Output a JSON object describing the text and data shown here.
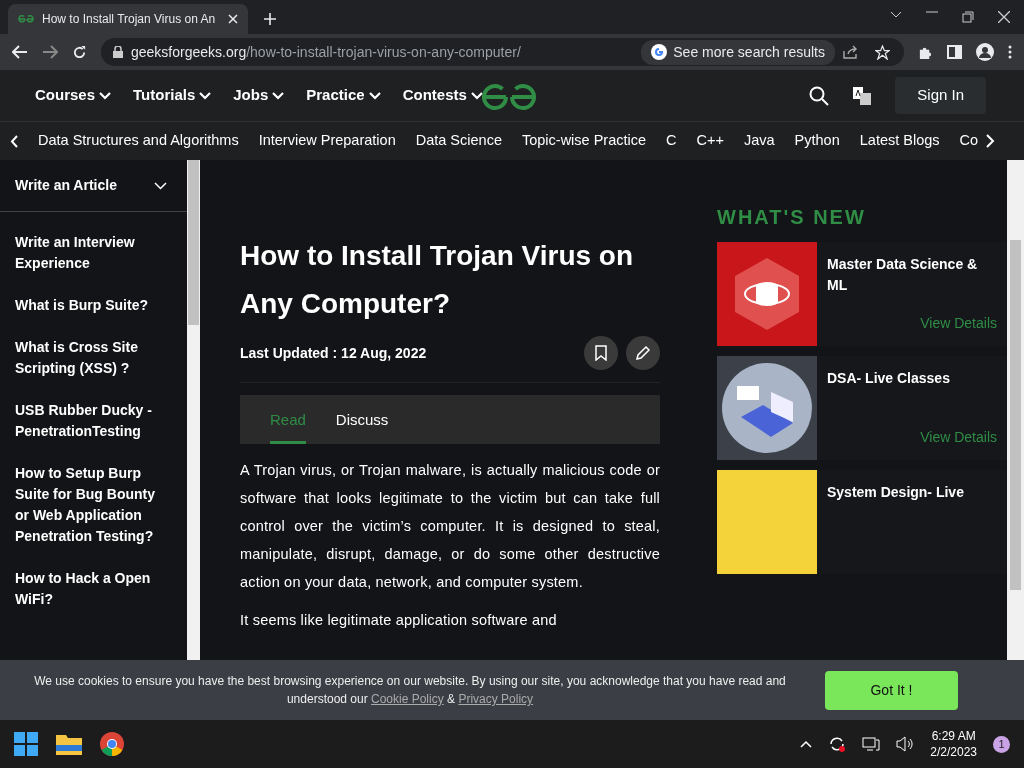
{
  "browser": {
    "tab_title": "How to Install Trojan Virus on An",
    "url_domain": "geeksforgeeks.org",
    "url_path": "/how-to-install-trojan-virus-on-any-computer/",
    "search_chip": "See more search results"
  },
  "site_nav": {
    "items": [
      "Courses",
      "Tutorials",
      "Jobs",
      "Practice",
      "Contests"
    ],
    "sign_in": "Sign In"
  },
  "topic_bar": [
    "Data Structures and Algorithms",
    "Interview Preparation",
    "Data Science",
    "Topic-wise Practice",
    "C",
    "C++",
    "Java",
    "Python",
    "Latest Blogs",
    "Co"
  ],
  "sidebar": {
    "header": "Write an Article",
    "items": [
      "Write an Interview Experience",
      "What is Burp Suite?",
      "What is Cross Site Scripting (XSS) ?",
      "USB Rubber Ducky - PenetrationTesting",
      "How to Setup Burp Suite for Bug Bounty or Web Application Penetration Testing?",
      "How to Hack a Open WiFi?"
    ]
  },
  "article": {
    "title": "How to Install Trojan Virus on Any Computer?",
    "updated": "Last Updated : 12 Aug, 2022",
    "tabs": [
      {
        "label": "Read",
        "selected": true
      },
      {
        "label": "Discuss",
        "selected": false
      }
    ],
    "paragraphs": [
      "A Trojan virus, or Trojan malware, is actually malicious code or software that looks legitimate to the victim but can take full control over the victim’s computer. It is designed to steal, manipulate, disrupt, damage, or do some other destructive action on your data, network, and computer system.",
      "It seems like legitimate application software and"
    ]
  },
  "whats_new": {
    "heading": "WHAT'S NEW",
    "items": [
      {
        "title": "Master Data Science & ML",
        "link": "View Details"
      },
      {
        "title": "DSA- Live Classes",
        "link": "View Details"
      },
      {
        "title": "System Design- Live"
      }
    ]
  },
  "cookie": {
    "text": "We use cookies to ensure you have the best browsing experience on our website. By using our site, you acknowledge that you have read and understood our",
    "link1": "Cookie Policy",
    "separator": "&",
    "link2": "Privacy Policy",
    "button": "Got It !"
  },
  "taskbar": {
    "time": "6:29 AM",
    "date": "2/2/2023",
    "badge": "1"
  }
}
